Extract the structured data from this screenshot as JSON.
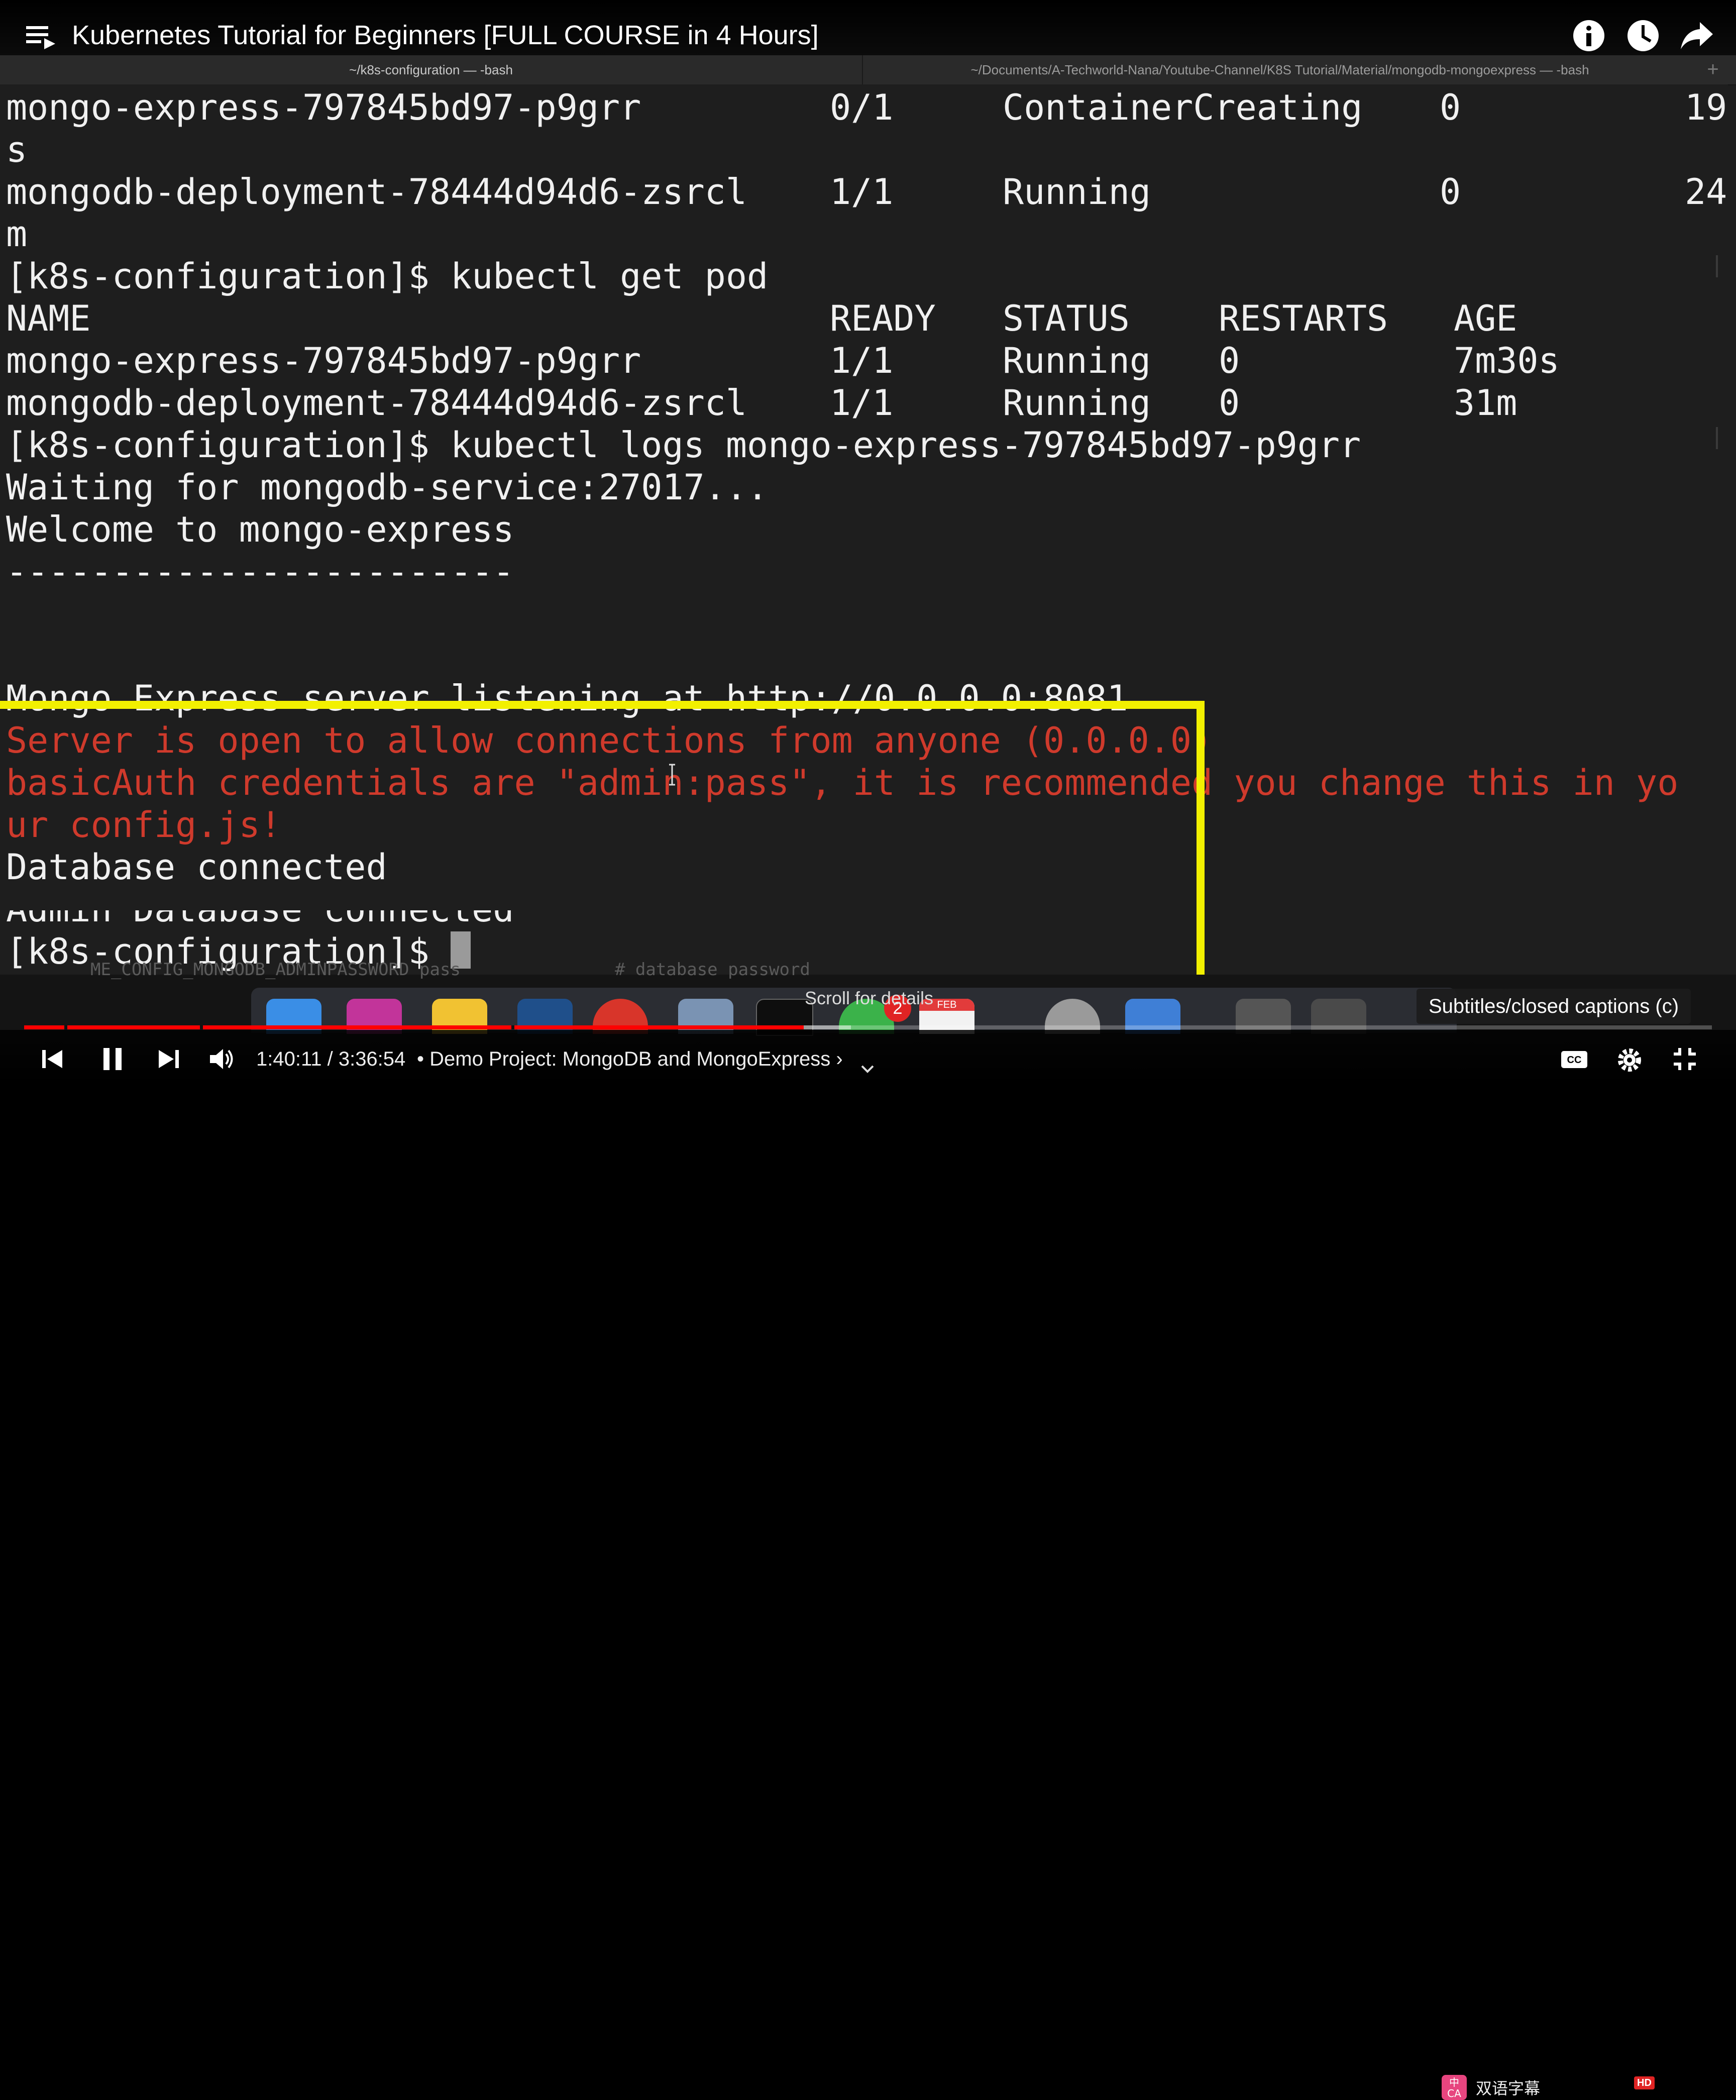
{
  "video": {
    "title": "Kubernetes Tutorial for Beginners [FULL COURSE in 4 Hours]"
  },
  "terminal": {
    "tabs": [
      {
        "title": "~/k8s-configuration — -bash",
        "active": true
      },
      {
        "title": "~/Documents/A-Techworld-Nana/Youtube-Channel/K8S Tutorial/Material/mongodb-mongoexpress — -bash",
        "active": false
      }
    ],
    "lines": [
      {
        "cols": [
          "mongo-express-797845bd97-p9grr",
          "0/1",
          "ContainerCreating",
          "0",
          "19"
        ]
      },
      {
        "text": "s"
      },
      {
        "cols": [
          "mongodb-deployment-78444d94d6-zsrcl",
          "1/1",
          "Running",
          "0",
          "24"
        ]
      },
      {
        "text": "m"
      },
      {
        "text": "[k8s-configuration]$ kubectl get pod"
      },
      {
        "cols": [
          "NAME",
          "READY",
          "STATUS",
          "RESTARTS",
          "AGE"
        ]
      },
      {
        "cols": [
          "mongo-express-797845bd97-p9grr",
          "1/1",
          "Running",
          "0",
          "7m30s"
        ]
      },
      {
        "cols": [
          "mongodb-deployment-78444d94d6-zsrcl",
          "1/1",
          "Running",
          "0",
          "31m"
        ]
      },
      {
        "text": "[k8s-configuration]$ kubectl logs mongo-express-797845bd97-p9grr"
      },
      {
        "text": "Waiting for mongodb-service:27017..."
      },
      {
        "text": "Welcome to mongo-express"
      },
      {
        "text": "------------------------"
      },
      {
        "text": ""
      },
      {
        "text": ""
      },
      {
        "text": "Mongo Express server listening at http://0.0.0.0:8081"
      },
      {
        "text": "Server is open to allow connections from anyone (0.0.0.0)",
        "color": "red"
      },
      {
        "text": "basicAuth credentials are \"admin:pass\", it is recommended you change this in yo",
        "color": "red"
      },
      {
        "text": "ur config.js!",
        "color": "red"
      },
      {
        "text": "Database connected"
      },
      {
        "text": "Admin Database connected"
      },
      {
        "text": "[k8s-configuration]$ "
      }
    ],
    "below_text": "ME_CONFIG_MONGODB_ADMINPASSWORD pass               # database password"
  },
  "dock": {
    "notification_badge": "2",
    "calendar_month": "FEB"
  },
  "tooltip": "Subtitles/closed captions (c)",
  "player": {
    "current_time": "1:40:11",
    "duration": "3:36:54",
    "time_display": "1:40:11 / 3:36:54",
    "chapter": "• Demo Project: MongoDB and MongoExpress ›",
    "played_fraction": 0.462,
    "loaded_fraction": 0.49,
    "scroll_hint": "Scroll for details",
    "bilingual_badge": "中\nCA",
    "bilingual_label": "双语字幕",
    "hd_label": "HD",
    "cc_label": "CC",
    "icons": [
      "playlist-icon",
      "info-icon",
      "watch-later-icon",
      "share-icon",
      "previous-icon",
      "pause-icon",
      "next-icon",
      "volume-icon",
      "cc-icon",
      "settings-icon",
      "exit-fullscreen-icon"
    ]
  }
}
